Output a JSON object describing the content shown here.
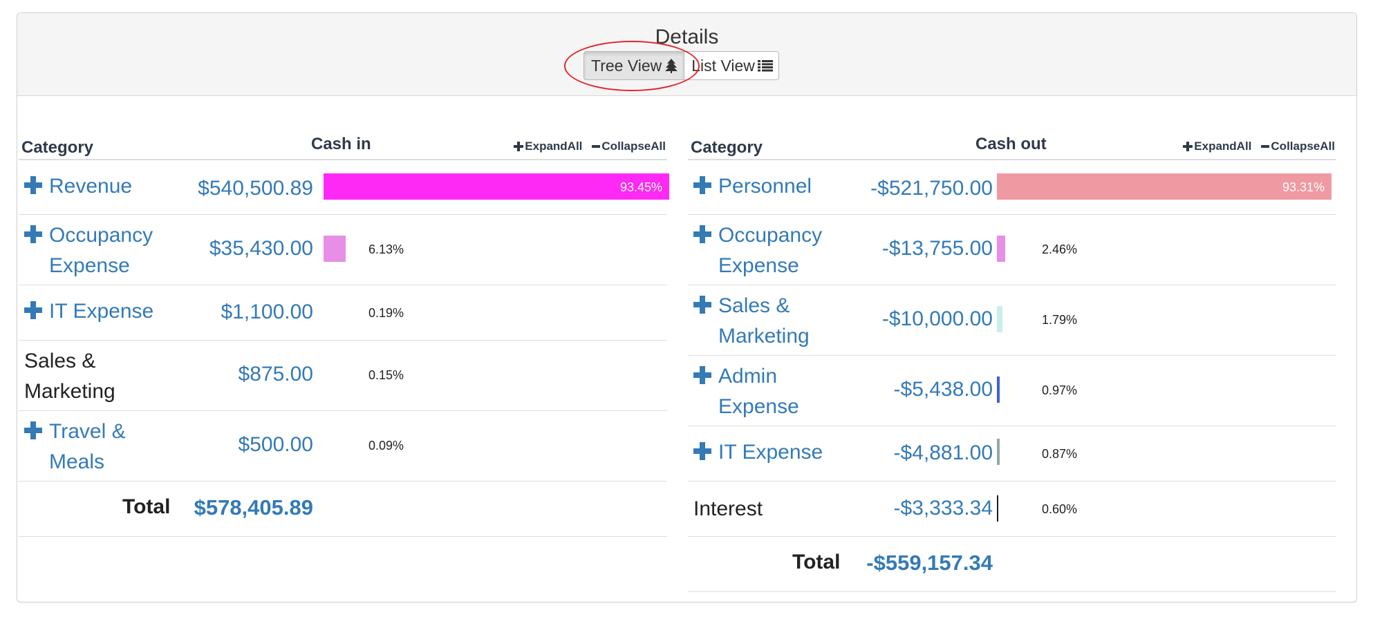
{
  "panel": {
    "title": "Details",
    "views": [
      {
        "label": "Tree View",
        "icon": "tree-icon",
        "active": true
      },
      {
        "label": "List View",
        "icon": "list-icon",
        "active": false
      }
    ]
  },
  "cash_in": {
    "headers": {
      "category": "Category",
      "amount": "Cash in",
      "expand_all": "ExpandAll",
      "collapse_all": "CollapseAll"
    },
    "rows": [
      {
        "category": "Revenue",
        "amount": "$540,500.89",
        "percent": "93.45%",
        "expandable": true,
        "bar_fraction": 0.9345,
        "bar_color": "#ff29f5"
      },
      {
        "category": "Occupancy Expense",
        "amount": "$35,430.00",
        "percent": "6.13%",
        "expandable": true,
        "bar_fraction": 0.0613,
        "bar_color": "#e78ee6"
      },
      {
        "category": "IT Expense",
        "amount": "$1,100.00",
        "percent": "0.19%",
        "expandable": true,
        "bar_fraction": 0.0019,
        "bar_color": "#e78ee6"
      },
      {
        "category": "Sales & Marketing",
        "amount": "$875.00",
        "percent": "0.15%",
        "expandable": false,
        "bar_fraction": 0.0015,
        "bar_color": "#e78ee6"
      },
      {
        "category": "Travel & Meals",
        "amount": "$500.00",
        "percent": "0.09%",
        "expandable": true,
        "bar_fraction": 0.0009,
        "bar_color": "#e78ee6"
      }
    ],
    "total_label": "Total",
    "total_amount": "$578,405.89"
  },
  "cash_out": {
    "headers": {
      "category": "Category",
      "amount": "Cash out",
      "expand_all": "ExpandAll",
      "collapse_all": "CollapseAll"
    },
    "rows": [
      {
        "category": "Personnel",
        "amount": "-$521,750.00",
        "percent": "93.31%",
        "expandable": true,
        "bar_fraction": 0.9331,
        "bar_color": "#ef9aa2"
      },
      {
        "category": "Occupancy Expense",
        "amount": "-$13,755.00",
        "percent": "2.46%",
        "expandable": true,
        "bar_fraction": 0.0246,
        "bar_color": "#e78ee6"
      },
      {
        "category": "Sales & Marketing",
        "amount": "-$10,000.00",
        "percent": "1.79%",
        "expandable": true,
        "bar_fraction": 0.0179,
        "bar_color": "#c9efe9"
      },
      {
        "category": "Admin Expense",
        "amount": "-$5,438.00",
        "percent": "0.97%",
        "expandable": true,
        "bar_fraction": 0.0097,
        "bar_color": "#3f5fd6"
      },
      {
        "category": "IT Expense",
        "amount": "-$4,881.00",
        "percent": "0.87%",
        "expandable": true,
        "bar_fraction": 0.0087,
        "bar_color": "#93a8a8"
      },
      {
        "category": "Interest",
        "amount": "-$3,333.34",
        "percent": "0.60%",
        "expandable": false,
        "bar_fraction": 0.006,
        "bar_color": "#1b1b2a"
      }
    ],
    "total_label": "Total",
    "total_amount": "-$559,157.34"
  }
}
